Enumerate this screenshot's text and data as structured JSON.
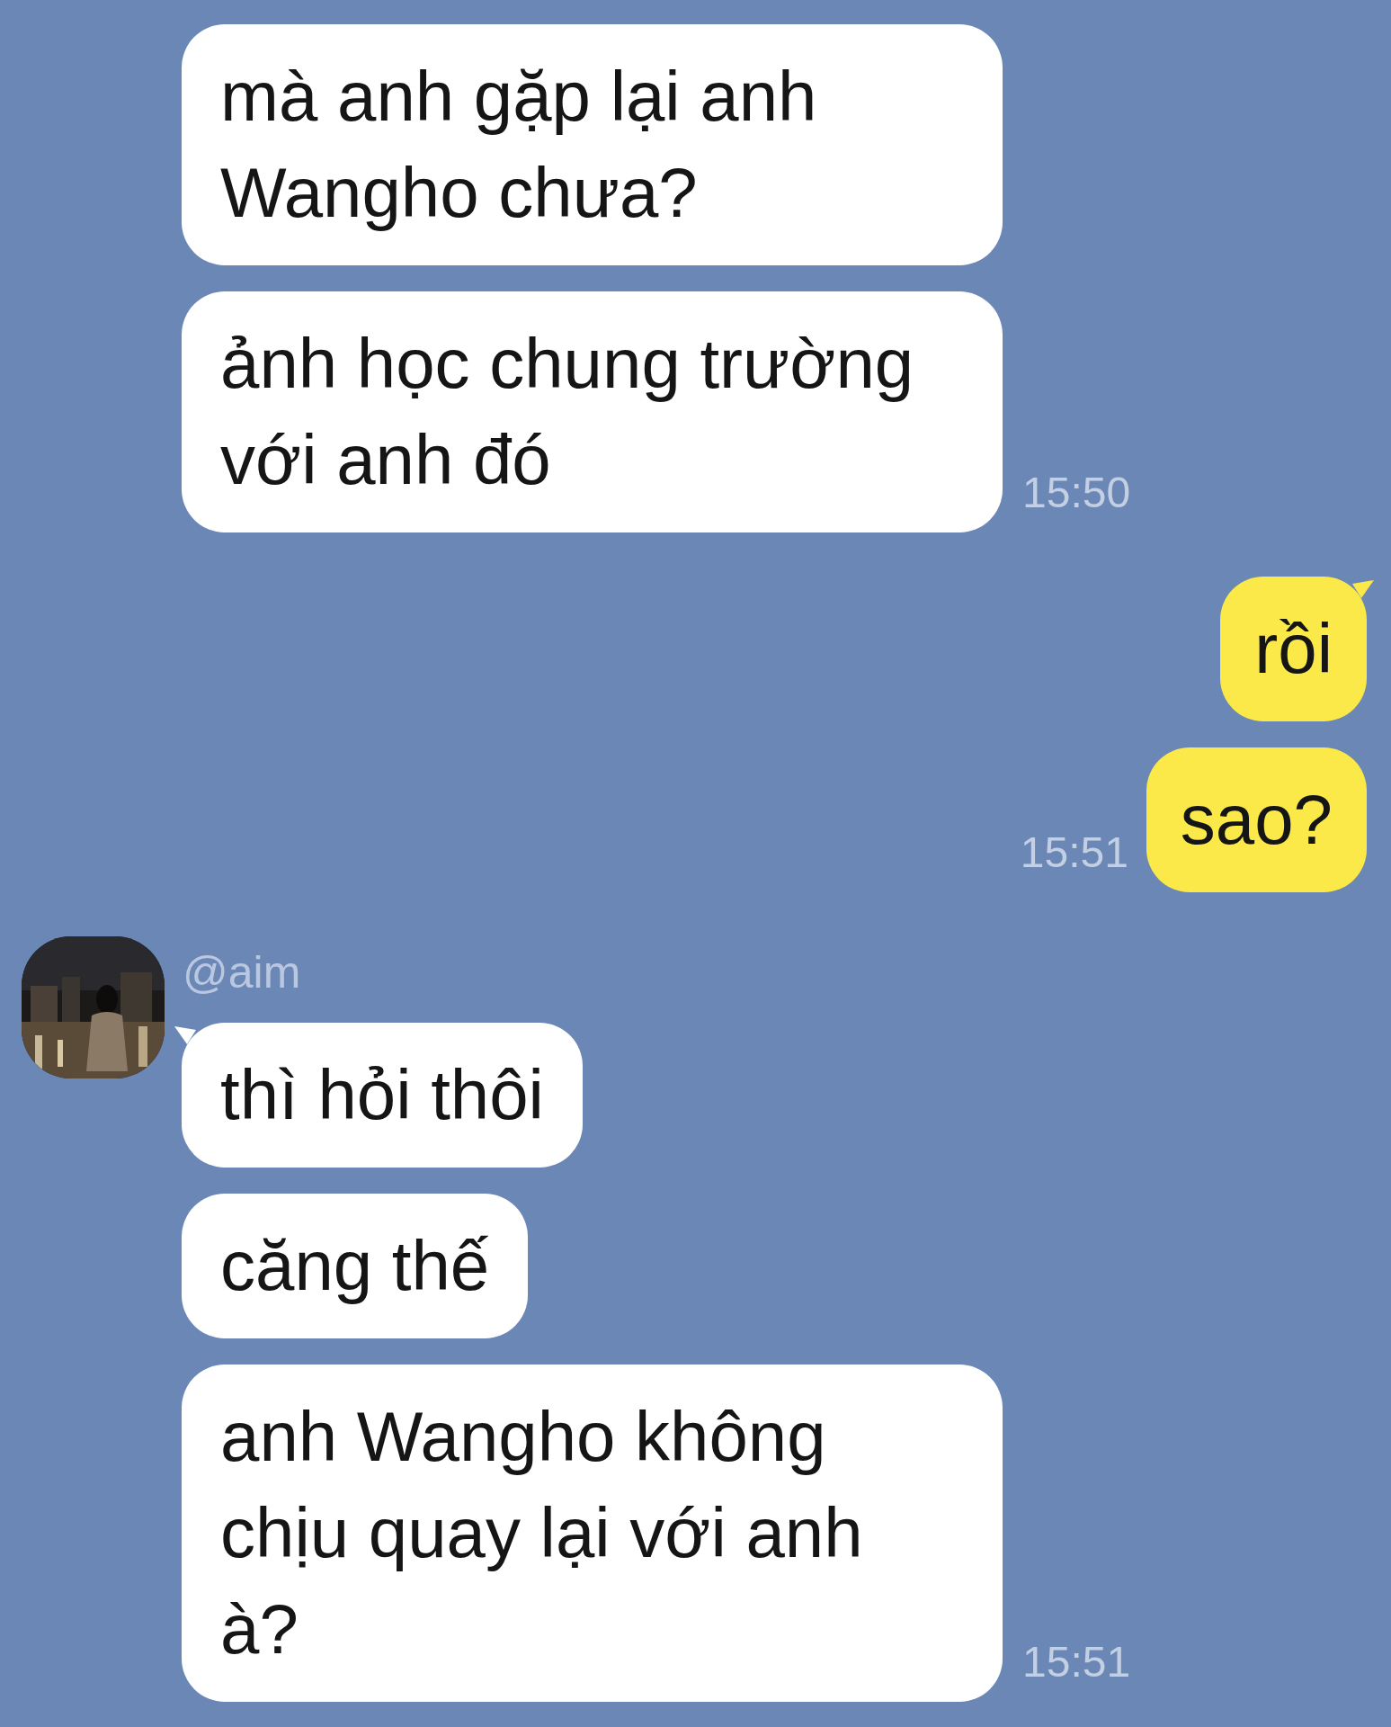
{
  "messages": [
    {
      "kind": "incoming",
      "text": "mà anh gặp lại anh\nWangho chưa?",
      "tail": false
    },
    {
      "kind": "incoming",
      "text": "ảnh học chung trường\nvới anh đó",
      "tail": false,
      "time": "15:50"
    },
    {
      "kind": "outgoing",
      "text": "rồi",
      "tail": true
    },
    {
      "kind": "outgoing",
      "text": "sao?",
      "tail": false,
      "time": "15:51"
    },
    {
      "kind": "sender",
      "name": "@aim"
    },
    {
      "kind": "incoming",
      "text": "thì hỏi thôi",
      "tail": true
    },
    {
      "kind": "incoming",
      "text": "căng thế",
      "tail": false
    },
    {
      "kind": "incoming",
      "text": "anh Wangho không\nchịu quay lại với anh\nà?",
      "tail": false,
      "time": "15:51"
    }
  ]
}
